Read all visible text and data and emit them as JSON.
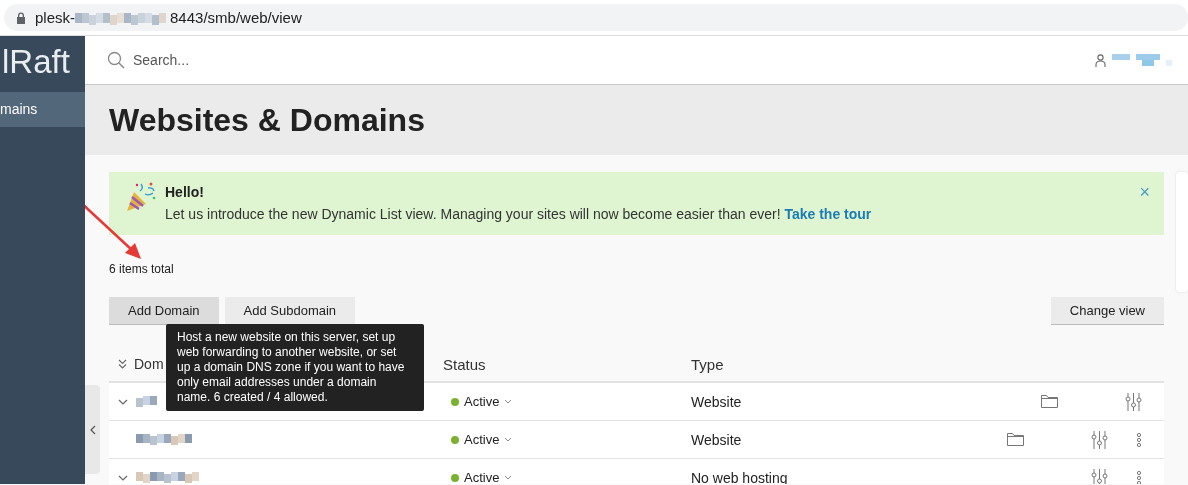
{
  "browser": {
    "url_prefix": "plesk-",
    "url_suffix": "8443/smb/web/view"
  },
  "sidebar": {
    "logo": "lRaft",
    "items": [
      {
        "label": "mains",
        "selected": true
      }
    ]
  },
  "header": {
    "search": {
      "placeholder": "Search..."
    }
  },
  "page": {
    "title": "Websites & Domains"
  },
  "banner": {
    "title": "Hello!",
    "text": "Let us introduce the new Dynamic List view. Managing your sites will now become easier than ever!",
    "link": "Take the tour",
    "close": "×"
  },
  "items_total": "6 items total",
  "buttons": [
    {
      "label": "Add Domain",
      "selected": true
    },
    {
      "label": "Add Subdomain",
      "selected": false
    }
  ],
  "change_view": "Change view",
  "tooltip": "Host a new website on this server, set up web forwarding to another website, or set up a domain DNS zone if you want to have only email addresses under a domain name. 6 created / 4 allowed.",
  "table": {
    "columns": [
      "Dom",
      "Status",
      "Type"
    ],
    "rows": [
      {
        "expandable": true,
        "status": "Active",
        "type": "Website",
        "actions": [
          {
            "kind": "folder"
          },
          {
            "kind": "settings"
          }
        ]
      },
      {
        "expandable": false,
        "status": "Active",
        "type": "Website",
        "actions": [
          {
            "kind": "folder"
          },
          {
            "kind": "settings"
          },
          {
            "kind": "more"
          }
        ]
      },
      {
        "expandable": true,
        "status": "Active",
        "type": "No web hosting",
        "actions": [
          {
            "kind": "settings"
          },
          {
            "kind": "more"
          }
        ]
      }
    ]
  }
}
